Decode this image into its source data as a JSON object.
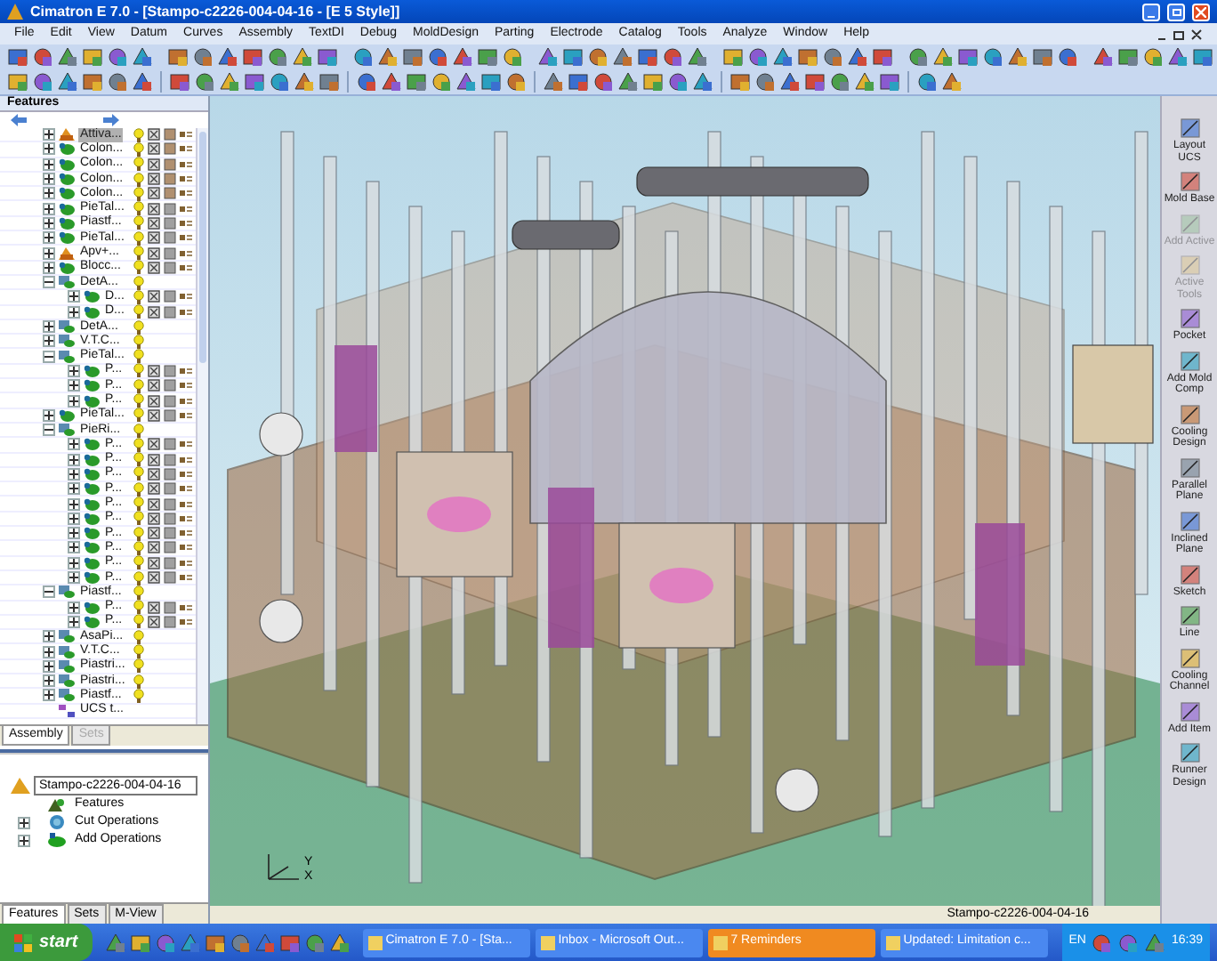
{
  "window": {
    "title": "Cimatron E 7.0 - [Stampo-c2226-004-04-16 - [E 5 Style]]"
  },
  "menu": [
    "File",
    "Edit",
    "View",
    "Datum",
    "Curves",
    "Assembly",
    "TextDI",
    "Debug",
    "MoldDesign",
    "Parting",
    "Electrode",
    "Catalog",
    "Tools",
    "Analyze",
    "Window",
    "Help"
  ],
  "features_panel": {
    "title": "Features",
    "tree": [
      {
        "label": "Attiva...",
        "kind": "active",
        "expanded": false,
        "selected": true
      },
      {
        "label": "Colon...",
        "kind": "part",
        "expanded": false,
        "selected": false
      },
      {
        "label": "Colon...",
        "kind": "part",
        "expanded": false,
        "selected": false
      },
      {
        "label": "Colon...",
        "kind": "part",
        "expanded": false,
        "selected": false
      },
      {
        "label": "Colon...",
        "kind": "part",
        "expanded": false,
        "selected": false
      },
      {
        "label": "PieTal...",
        "kind": "part",
        "expanded": false,
        "selected": false
      },
      {
        "label": "Piastf...",
        "kind": "part",
        "expanded": false,
        "selected": false
      },
      {
        "label": "PieTal...",
        "kind": "part",
        "expanded": false,
        "selected": false
      },
      {
        "label": "Apv+...",
        "kind": "active",
        "expanded": false,
        "selected": false
      },
      {
        "label": "Blocc...",
        "kind": "part",
        "expanded": false,
        "selected": false
      },
      {
        "label": "DetA...",
        "kind": "assembly",
        "expanded": true,
        "selected": false,
        "children": [
          {
            "label": "D...",
            "kind": "part",
            "expanded": false,
            "selected": false
          },
          {
            "label": "D...",
            "kind": "part",
            "expanded": false,
            "selected": false
          }
        ]
      },
      {
        "label": "DetA...",
        "kind": "assembly",
        "expanded": false,
        "selected": false
      },
      {
        "label": "V.T.C...",
        "kind": "assembly",
        "expanded": false,
        "selected": false
      },
      {
        "label": "PieTal...",
        "kind": "assembly",
        "expanded": true,
        "selected": false,
        "children": [
          {
            "label": "P...",
            "kind": "part",
            "expanded": false,
            "selected": false
          },
          {
            "label": "P...",
            "kind": "part",
            "expanded": false,
            "selected": false
          },
          {
            "label": "P...",
            "kind": "part",
            "expanded": false,
            "selected": false
          }
        ]
      },
      {
        "label": "PieTal...",
        "kind": "part",
        "expanded": false,
        "selected": false
      },
      {
        "label": "PieRi...",
        "kind": "assembly",
        "expanded": true,
        "selected": false,
        "children": [
          {
            "label": "P...",
            "kind": "part",
            "expanded": false,
            "selected": false
          },
          {
            "label": "P...",
            "kind": "part",
            "expanded": false,
            "selected": false
          },
          {
            "label": "P...",
            "kind": "part",
            "expanded": false,
            "selected": false
          },
          {
            "label": "P...",
            "kind": "part",
            "expanded": false,
            "selected": false
          },
          {
            "label": "P...",
            "kind": "part",
            "expanded": false,
            "selected": false
          },
          {
            "label": "P...",
            "kind": "part",
            "expanded": false,
            "selected": false
          },
          {
            "label": "P...",
            "kind": "part",
            "expanded": false,
            "selected": false
          },
          {
            "label": "P...",
            "kind": "part",
            "expanded": false,
            "selected": false
          },
          {
            "label": "P...",
            "kind": "part",
            "expanded": false,
            "selected": false
          },
          {
            "label": "P...",
            "kind": "part",
            "expanded": false,
            "selected": false
          }
        ]
      },
      {
        "label": "Piastf...",
        "kind": "assembly",
        "expanded": true,
        "selected": false,
        "children": [
          {
            "label": "P...",
            "kind": "part",
            "expanded": false,
            "selected": false
          },
          {
            "label": "P...",
            "kind": "part",
            "expanded": false,
            "selected": false
          }
        ]
      },
      {
        "label": "AsaPi...",
        "kind": "assembly",
        "expanded": false,
        "selected": false
      },
      {
        "label": "V.T.C...",
        "kind": "assembly",
        "expanded": false,
        "selected": false
      },
      {
        "label": "Piastri...",
        "kind": "assembly",
        "expanded": false,
        "selected": false
      },
      {
        "label": "Piastri...",
        "kind": "assembly",
        "expanded": false,
        "selected": false
      },
      {
        "label": "Piastf...",
        "kind": "assembly",
        "expanded": false,
        "selected": false
      },
      {
        "label": "UCS t...",
        "kind": "ucs",
        "selected": false
      }
    ],
    "tabs": [
      {
        "label": "Assembly",
        "selected": true,
        "disabled": false
      },
      {
        "label": "Sets",
        "selected": false,
        "disabled": true
      }
    ]
  },
  "lower_panel": {
    "tree": [
      {
        "label": "Stampo-c2226-004-04-16",
        "kind": "root",
        "selected": true,
        "children": [
          {
            "label": "Features",
            "kind": "features",
            "selected": false
          },
          {
            "label": "Cut Operations",
            "kind": "cut",
            "expanded": false,
            "selected": false
          },
          {
            "label": "Add Operations",
            "kind": "add",
            "expanded": false,
            "selected": false
          }
        ]
      }
    ],
    "tabs": [
      {
        "label": "Features",
        "selected": true
      },
      {
        "label": "Sets",
        "selected": false
      },
      {
        "label": "M-View",
        "selected": false
      }
    ]
  },
  "viewport": {
    "axis_labels": [
      "Y",
      "X"
    ]
  },
  "right_toolbar": [
    {
      "label": "Layout UCS",
      "disabled": false
    },
    {
      "label": "Mold Base",
      "disabled": false
    },
    {
      "label": "Add Active",
      "disabled": true
    },
    {
      "label": "Active Tools",
      "disabled": true
    },
    {
      "label": "Pocket",
      "disabled": false
    },
    {
      "label": "Add Mold Comp",
      "disabled": false
    },
    {
      "label": "Cooling Design",
      "disabled": false
    },
    {
      "label": "Parallel Plane",
      "disabled": false
    },
    {
      "label": "Inclined Plane",
      "disabled": false
    },
    {
      "label": "Sketch",
      "disabled": false
    },
    {
      "label": "Line",
      "disabled": false
    },
    {
      "label": "Cooling Channel",
      "disabled": false
    },
    {
      "label": "Add Item",
      "disabled": false
    },
    {
      "label": "Runner Design",
      "disabled": false
    }
  ],
  "status_bar": {
    "text": "Stampo-c2226-004-04-16"
  },
  "taskbar": {
    "start": "start",
    "tasks": [
      {
        "label": "Cimatron E 7.0 - [Sta...",
        "alert": false
      },
      {
        "label": "Inbox - Microsoft Out...",
        "alert": false
      },
      {
        "label": "7 Reminders",
        "alert": true
      },
      {
        "label": "Updated: Limitation c...",
        "alert": false
      }
    ],
    "language": "EN",
    "clock": "16:39"
  }
}
